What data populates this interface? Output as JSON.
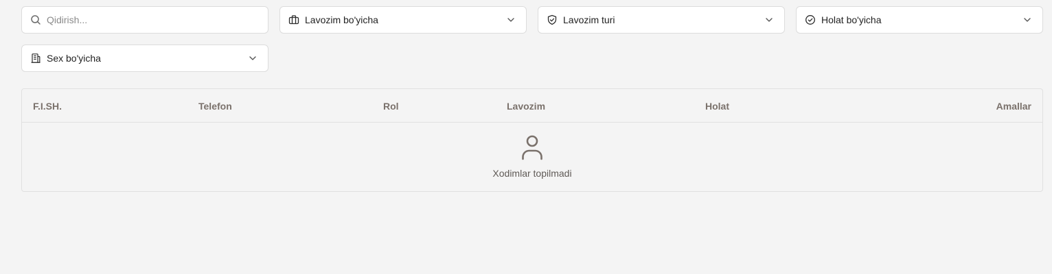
{
  "filters": {
    "search": {
      "placeholder": "Qidirish...",
      "value": ""
    },
    "position": {
      "label": "Lavozim bo'yicha",
      "icon": "briefcase-icon"
    },
    "position_type": {
      "label": "Lavozim turi",
      "icon": "shield-check-icon"
    },
    "status": {
      "label": "Holat bo'yicha",
      "icon": "circle-check-icon"
    },
    "shop": {
      "label": "Sex bo'yicha",
      "icon": "building-icon"
    }
  },
  "table": {
    "columns": [
      "F.I.SH.",
      "Telefon",
      "Rol",
      "Lavozim",
      "Holat",
      "Amallar"
    ],
    "rows": [],
    "empty_message": "Xodimlar topilmadi",
    "empty_icon": "user-icon"
  },
  "colors": {
    "background": "#f4f4f4",
    "header_text": "#7a716b",
    "icon": "#7a716b"
  }
}
